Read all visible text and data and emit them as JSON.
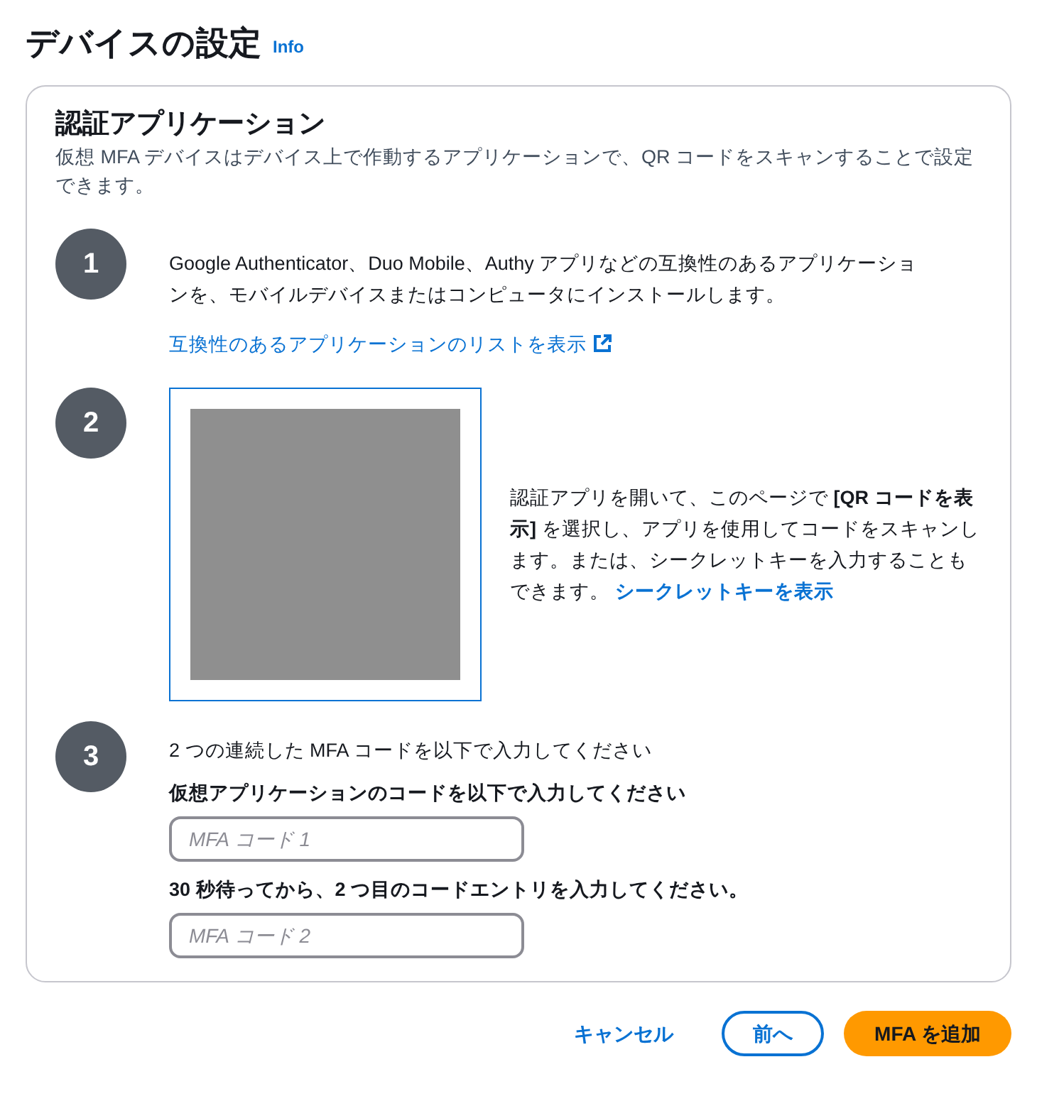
{
  "page": {
    "title": "デバイスの設定",
    "info_link": "Info"
  },
  "card": {
    "title": "認証アプリケーション",
    "description": "仮想 MFA デバイスはデバイス上で作動するアプリケーションで、QR コードをスキャンすることで設定できます。",
    "steps": [
      {
        "kind": "install",
        "number": "1",
        "text": "Google Authenticator、Duo Mobile、Authy アプリなどの互換性のあるアプリケーションを、モバイルデバイスまたはコンピュータにインストールします。",
        "link": "互換性のあるアプリケーションのリストを表示"
      },
      {
        "kind": "qr",
        "number": "2",
        "text": "認証アプリを開いて、このページで **[QR コードを表示]** を選択し、アプリを使用してコードをスキャンします。または、シークレットキーを入力することもできます。",
        "link": "シークレットキーを表示"
      },
      {
        "kind": "codes",
        "number": "3",
        "text": "2 つの連続した MFA コードを以下で入力してください",
        "fields": [
          {
            "label": "仮想アプリケーションのコードを以下で入力してください",
            "placeholder": "MFA コード 1"
          },
          {
            "label": "30 秒待ってから、2 つ目のコードエントリを入力してください。",
            "placeholder": "MFA コード 2"
          }
        ]
      }
    ]
  },
  "buttons": [
    {
      "kind": "link",
      "label": "キャンセル"
    },
    {
      "kind": "outline",
      "label": "前へ"
    },
    {
      "kind": "primary",
      "label": "MFA を追加"
    }
  ]
}
